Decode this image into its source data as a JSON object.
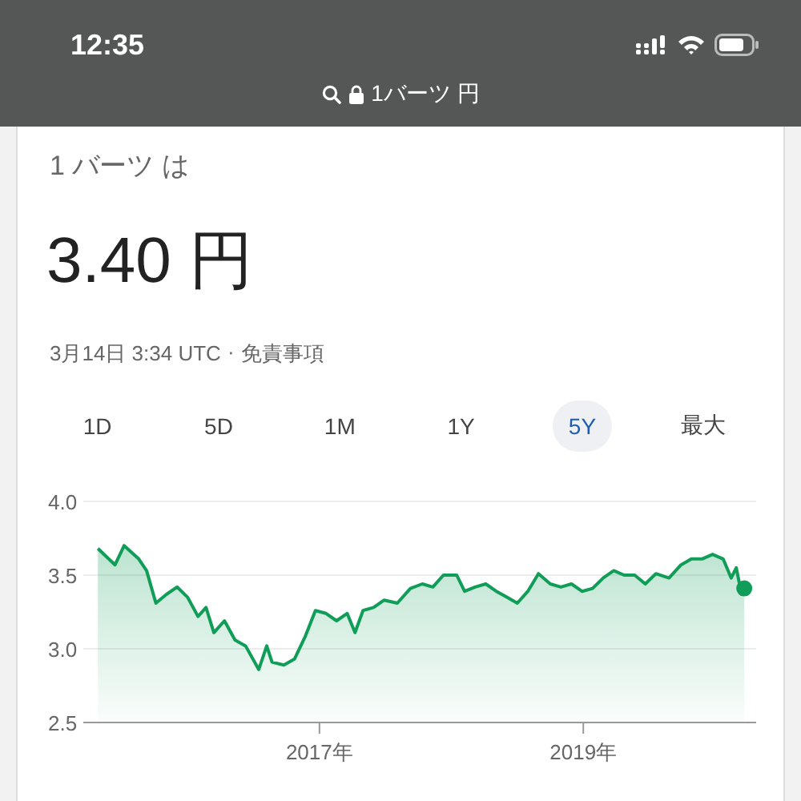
{
  "status_bar": {
    "time": "12:35"
  },
  "address_bar": {
    "url": "1バーツ 円"
  },
  "converter": {
    "heading": "1 バーツ は",
    "value": "3.40 円",
    "timestamp": "3月14日 3:34 UTC",
    "separator": "·",
    "disclaimer_link": "免責事項"
  },
  "range_tabs": [
    {
      "label": "1D",
      "selected": false
    },
    {
      "label": "5D",
      "selected": false
    },
    {
      "label": "1M",
      "selected": false
    },
    {
      "label": "1Y",
      "selected": false
    },
    {
      "label": "5Y",
      "selected": true
    },
    {
      "label": "最大",
      "selected": false
    }
  ],
  "chart_data": {
    "type": "area",
    "xlim": [
      2015.21,
      2020.31
    ],
    "ylim": [
      2.5,
      4.0
    ],
    "yticks": [
      {
        "value": 2.5,
        "label": "2.5"
      },
      {
        "value": 3,
        "label": "3.0"
      },
      {
        "value": 3.5,
        "label": "3.5"
      },
      {
        "value": 4,
        "label": "4.0"
      }
    ],
    "xticks": [
      {
        "value": 2017,
        "label": "2017年"
      },
      {
        "value": 2019,
        "label": "2019年"
      }
    ],
    "x": [
      2015.32,
      2015.45,
      2015.52,
      2015.63,
      2015.69,
      2015.76,
      2015.84,
      2015.92,
      2016.0,
      2016.08,
      2016.14,
      2016.2,
      2016.28,
      2016.36,
      2016.44,
      2016.54,
      2016.6,
      2016.64,
      2016.73,
      2016.81,
      2016.89,
      2016.97,
      2017.05,
      2017.13,
      2017.21,
      2017.27,
      2017.33,
      2017.41,
      2017.49,
      2017.59,
      2017.69,
      2017.78,
      2017.86,
      2017.94,
      2018.04,
      2018.1,
      2018.18,
      2018.26,
      2018.34,
      2018.42,
      2018.5,
      2018.58,
      2018.66,
      2018.75,
      2018.83,
      2018.91,
      2018.99,
      2019.07,
      2019.15,
      2019.23,
      2019.31,
      2019.39,
      2019.47,
      2019.55,
      2019.65,
      2019.74,
      2019.82,
      2019.9,
      2019.98,
      2020.06,
      2020.12,
      2020.16,
      2020.2,
      2020.22
    ],
    "series": [
      {
        "color": "#0f9d58",
        "values": [
          3.68,
          3.57,
          3.7,
          3.61,
          3.53,
          3.31,
          3.37,
          3.42,
          3.35,
          3.22,
          3.28,
          3.11,
          3.19,
          3.06,
          3.02,
          2.86,
          3.02,
          2.91,
          2.89,
          2.93,
          3.08,
          3.26,
          3.24,
          3.19,
          3.24,
          3.11,
          3.26,
          3.28,
          3.33,
          3.31,
          3.41,
          3.44,
          3.42,
          3.5,
          3.5,
          3.39,
          3.42,
          3.44,
          3.39,
          3.35,
          3.31,
          3.39,
          3.51,
          3.44,
          3.42,
          3.44,
          3.39,
          3.41,
          3.48,
          3.53,
          3.5,
          3.5,
          3.44,
          3.51,
          3.48,
          3.57,
          3.61,
          3.61,
          3.64,
          3.61,
          3.48,
          3.55,
          3.37,
          3.41
        ]
      }
    ]
  }
}
